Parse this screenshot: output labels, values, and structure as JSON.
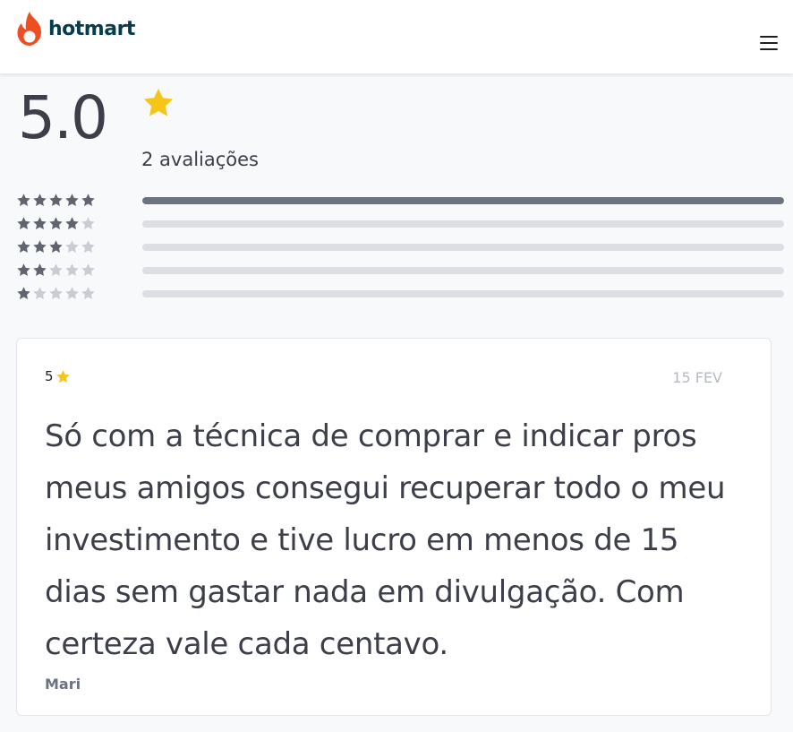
{
  "brand": {
    "name": "hotmart",
    "logo_color": "#ef4e23"
  },
  "header": {
    "menu_icon": "hamburger-menu-icon"
  },
  "summary": {
    "score": "5.0",
    "review_count_label": "2 avaliações",
    "star_color": "#f5c518",
    "distribution": [
      {
        "stars": 5,
        "fraction": 1.0
      },
      {
        "stars": 4,
        "fraction": 0.0
      },
      {
        "stars": 3,
        "fraction": 0.0
      },
      {
        "stars": 2,
        "fraction": 0.0
      },
      {
        "stars": 1,
        "fraction": 0.0
      }
    ]
  },
  "review": {
    "rating": "5",
    "date": "15 FEV",
    "text": "Só com a técnica de comprar e indicar pros meus amigos consegui recuperar todo o meu investimento e tive lucro em menos de 15 dias sem gastar nada em divulgação. Com certeza vale cada centavo.",
    "author": "Mari"
  }
}
